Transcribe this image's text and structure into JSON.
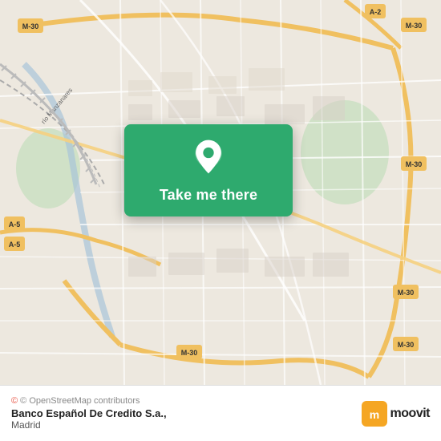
{
  "map": {
    "background_color": "#e8dfd0",
    "attribution": "© OpenStreetMap contributors"
  },
  "card": {
    "label": "Take me there",
    "pin_icon": "location-pin-icon"
  },
  "bottom_bar": {
    "place_name": "Banco Español De Credito S.a.,",
    "place_city": "Madrid",
    "moovit_label": "moovit"
  }
}
